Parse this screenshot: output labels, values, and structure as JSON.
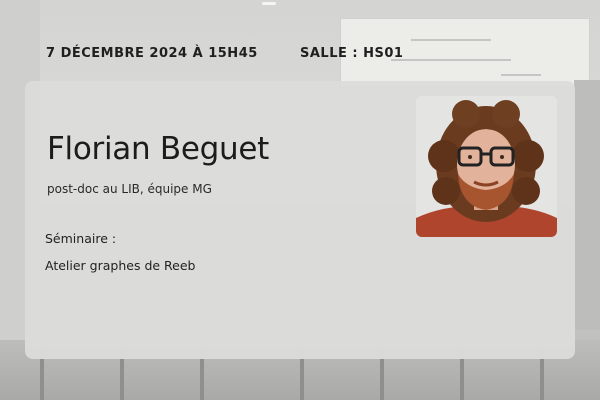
{
  "event": {
    "date": "7 DÉCEMBRE 2024 À 15H45",
    "room": "SALLE : HS01"
  },
  "speaker": {
    "name": "Florian Beguet",
    "role": "post-doc au LIB, équipe MG",
    "photo_icon": "speaker-portrait"
  },
  "seminar": {
    "label": "Séminaire :",
    "title": "Atelier graphes de Reeb"
  },
  "colors": {
    "card": "#dcdcdb",
    "text": "#1c1c1c",
    "sweater": "#b0452d"
  }
}
